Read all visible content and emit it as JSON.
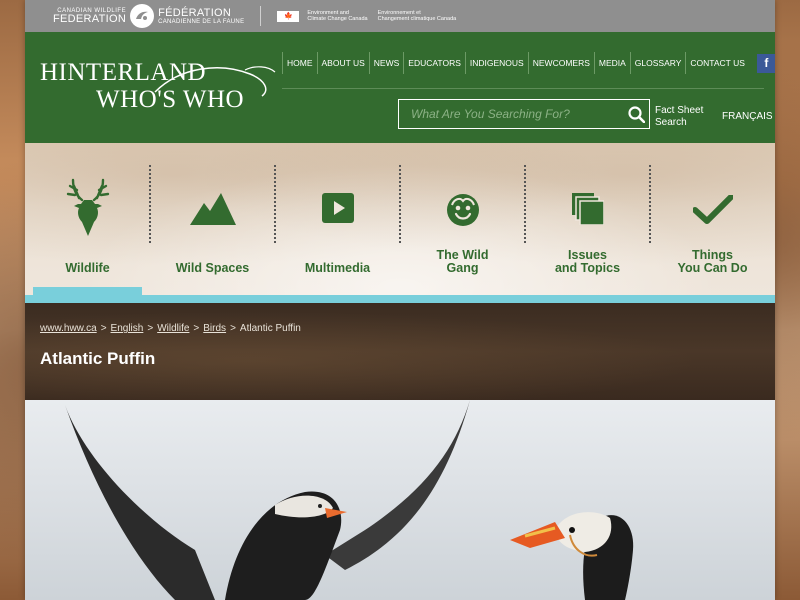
{
  "partner": {
    "cwf_small": "CANADIAN WILDLIFE",
    "cwf_big": "FEDERATION",
    "fcf_big": "FÉDÉRATION",
    "fcf_small": "CANADIENNE DE LA FAUNE",
    "eccc_en_1": "Environment and",
    "eccc_en_2": "Climate Change Canada",
    "eccc_fr_1": "Environnement et",
    "eccc_fr_2": "Changement climatique Canada"
  },
  "logo": {
    "line1": "HINTERLAND",
    "line2": "WHO'S WHO"
  },
  "topnav": [
    "HOME",
    "ABOUT US",
    "NEWS",
    "EDUCATORS",
    "INDIGENOUS",
    "NEWCOMERS",
    "MEDIA",
    "GLOSSARY",
    "CONTACT US"
  ],
  "search": {
    "placeholder": "What Are You Searching For?",
    "fact_sheet_1": "Fact Sheet",
    "fact_sheet_2": "Search"
  },
  "lang": "FRANÇAIS",
  "categories": [
    {
      "line1": "",
      "line2": "Wildlife",
      "icon": "deer-icon",
      "active": true
    },
    {
      "line1": "",
      "line2": "Wild Spaces",
      "icon": "mountain-icon",
      "active": false
    },
    {
      "line1": "",
      "line2": "Multimedia",
      "icon": "play-icon",
      "active": false
    },
    {
      "line1": "The Wild",
      "line2": "Gang",
      "icon": "face-icon",
      "active": false
    },
    {
      "line1": "Issues",
      "line2": "and Topics",
      "icon": "pages-icon",
      "active": false
    },
    {
      "line1": "Things",
      "line2": "You Can Do",
      "icon": "checkmark-icon",
      "active": false
    }
  ],
  "breadcrumb": {
    "home": "www.hww.ca",
    "english": "English",
    "wildlife": "Birds",
    "wildlife_a": "Wildlife",
    "current": "Atlantic Puffin"
  },
  "page_title": "Atlantic Puffin",
  "colors": {
    "green": "#336b2f",
    "accent": "#79cfdb"
  }
}
